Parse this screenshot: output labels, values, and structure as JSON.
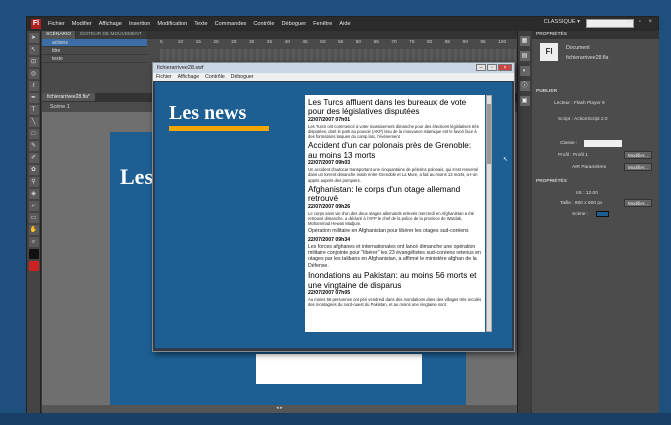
{
  "app": {
    "logo": "Fl",
    "menus": [
      "Fichier",
      "Modifier",
      "Affichage",
      "Insertion",
      "Modification",
      "Texte",
      "Commandes",
      "Contrôle",
      "Déboguer",
      "Fenêtre",
      "Aide"
    ],
    "workspace": "CLASSIQUE ▾",
    "window_buttons": "– ▫ ×"
  },
  "timeline": {
    "tabs": [
      "SCÉNARIO",
      "ÉDITEUR DE MOUVEMENT"
    ],
    "layers": [
      "actions",
      "titre",
      "texte"
    ],
    "ruler": [
      "5",
      "10",
      "15",
      "20",
      "25",
      "30",
      "35",
      "40",
      "45",
      "50",
      "55",
      "60",
      "65",
      "70",
      "75",
      "80",
      "85",
      "90",
      "95",
      "100"
    ]
  },
  "document": {
    "tab": "fichierarrivee28.fla*",
    "scene": "Scène 1"
  },
  "stage": {
    "title": "Les n"
  },
  "properties": {
    "tab": "PROPRIÉTÉS",
    "type": "Document",
    "file": "fichierarrivee28.fla",
    "publish_heading": "PUBLIER",
    "player": "Lecteur : Flash Player 9",
    "script": "Script : ActionScript 2.0",
    "class_label": "Classe :",
    "profile": "Profil : Profil 1",
    "profile_btn": "Modifier...",
    "air": "AIR Paramètres",
    "air_btn": "Modifier...",
    "props_heading": "PROPRIÉTÉS",
    "fps": "IIS : 12.00",
    "size": "Taille : 800 x 600 px",
    "size_btn": "Modifier...",
    "stage_label": "Scène :",
    "stage_color": "#1d5f93"
  },
  "swf_window": {
    "title": "fichierarrivee28.swf",
    "menus": [
      "Fichier",
      "Affichage",
      "Contrôle",
      "Déboguer"
    ],
    "heading": "Les news",
    "accent": "#f2a800",
    "articles": [
      {
        "headline": "Les Turcs affluent dans les bureaux de vote pour des législatives disputées",
        "date": "22/07/2007 07h01",
        "body": "Les Turcs ont commencé à voter massivement dimanche pour des élections législatives très disputées, dont le parti au pouvoir (AKP) issu de la mouvance islamique est le favori face à des formations laïques du camp laïc, l'événement"
      },
      {
        "headline": "Accident d'un car polonais près de Grenoble: au moins 13 morts",
        "date": "22/07/2007 09h03",
        "body": "Un accident d'autocar transportant une cinquantaine de pèlerins polonais, qui s'est renversé dans un torrent dimanche matin entre Grenoble et La Mure, a fait au moins 13 morts, a-t-on appris auprès des pompiers."
      },
      {
        "headline": "Afghanistan: le corps d'un otage allemand retrouvé",
        "date": "22/07/2007 09h26",
        "body": "Le corps sans vie d'un des deux otages allemands enlevés mercredi en Afghanistan a été retrouvé dimanche, a déclaré à l'AFP le chef de la police de la province de Wardak, Mohammad Hewas Madjum."
      },
      {
        "headline": "",
        "date": "",
        "body": "Opération militaire en Afghanistan pour libérer les otages sud-coréens"
      },
      {
        "headline": "",
        "date": "22/07/2007 09h34",
        "body": "Les forces afghanes et internationales ont lancé dimanche une opération militaire conjointe pour \"libérer\" les 23 évangélistes sud-coréens retenus en otages par les talibans en Afghanistan, a affirmé le ministère afghan de la Défense."
      },
      {
        "headline": "Inondations au Pakistan: au moins 56 morts et une vingtaine de disparus",
        "date": "22/07/2007 07h05",
        "body": "Au moins 56 personnes ont péri vendredi dans des inondations dans des villages très reculés des montagnes du nord-ouest du Pakistan, et au moins une vingtaine sont"
      }
    ]
  }
}
